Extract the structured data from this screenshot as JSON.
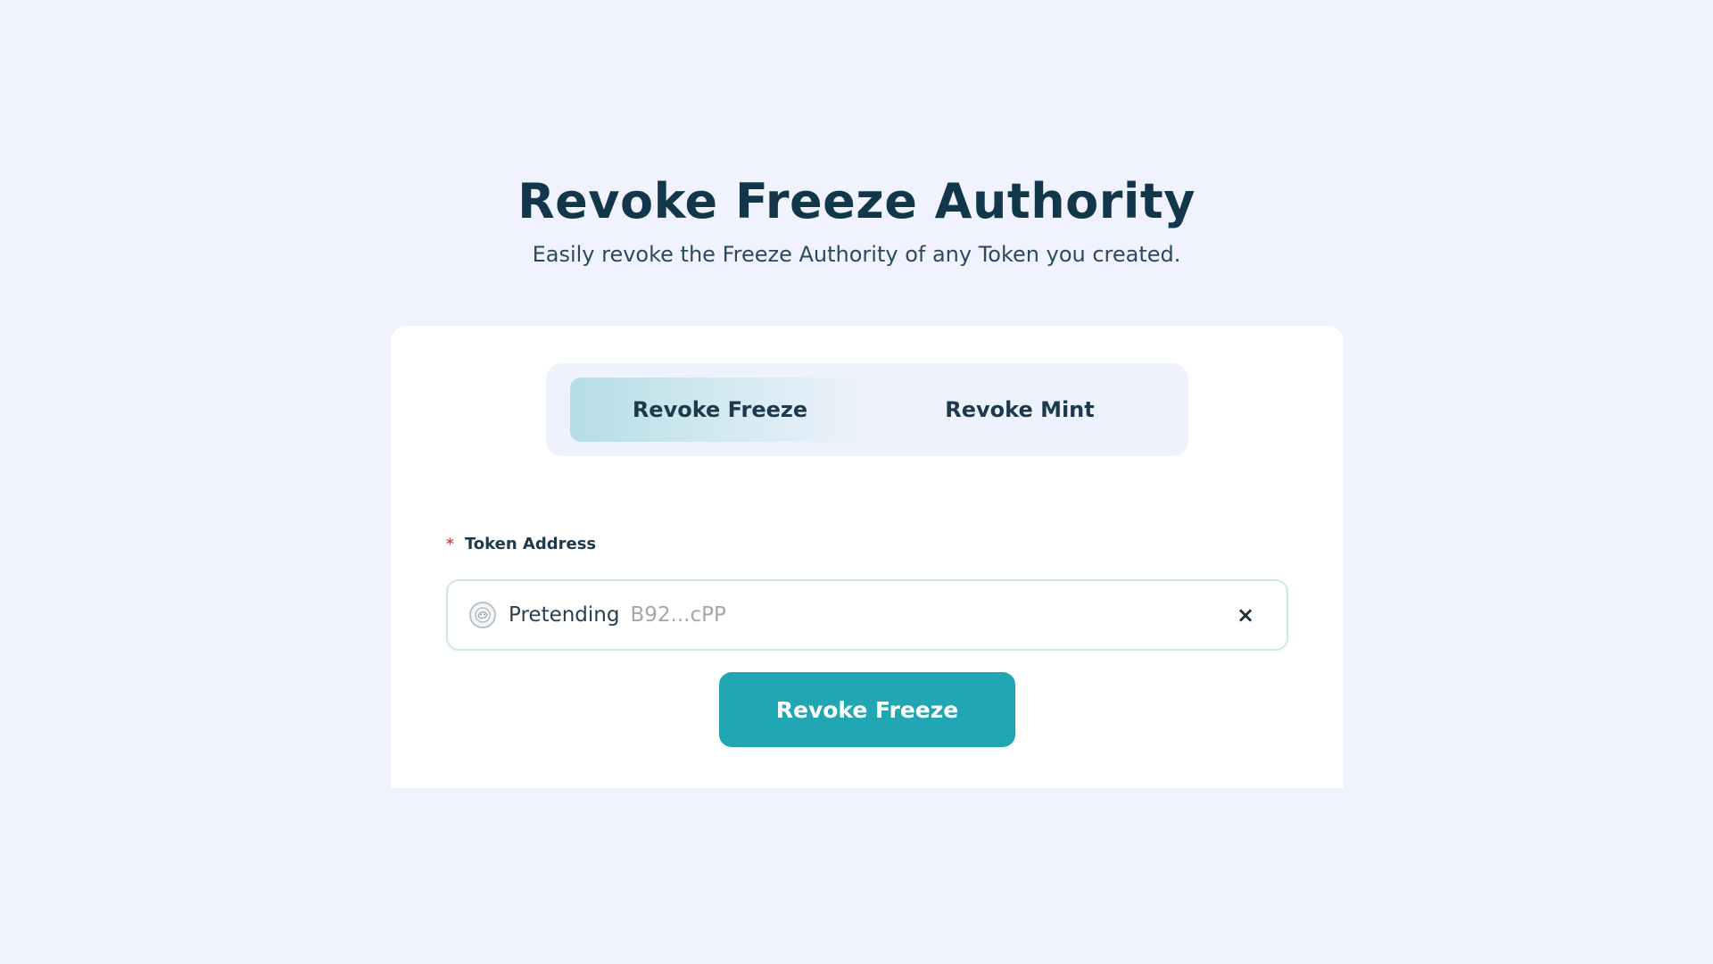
{
  "header": {
    "title": "Revoke Freeze Authority",
    "subtitle": "Easily revoke the Freeze Authority of any Token you created."
  },
  "tabs": [
    {
      "label": "Revoke Freeze",
      "active": true
    },
    {
      "label": "Revoke Mint",
      "active": false
    }
  ],
  "form": {
    "required_marker": "*",
    "token_label": "Token Address",
    "selected_token": {
      "name": "Pretending",
      "address": "B92...cPP",
      "icon": "token-avatar-icon"
    },
    "clear_symbol": "×",
    "submit_label": "Revoke Freeze"
  },
  "colors": {
    "background": "#f0f3fe",
    "card": "#ffffff",
    "primary": "#21a6b3",
    "title_text": "#12364a",
    "required": "#e5484d"
  }
}
